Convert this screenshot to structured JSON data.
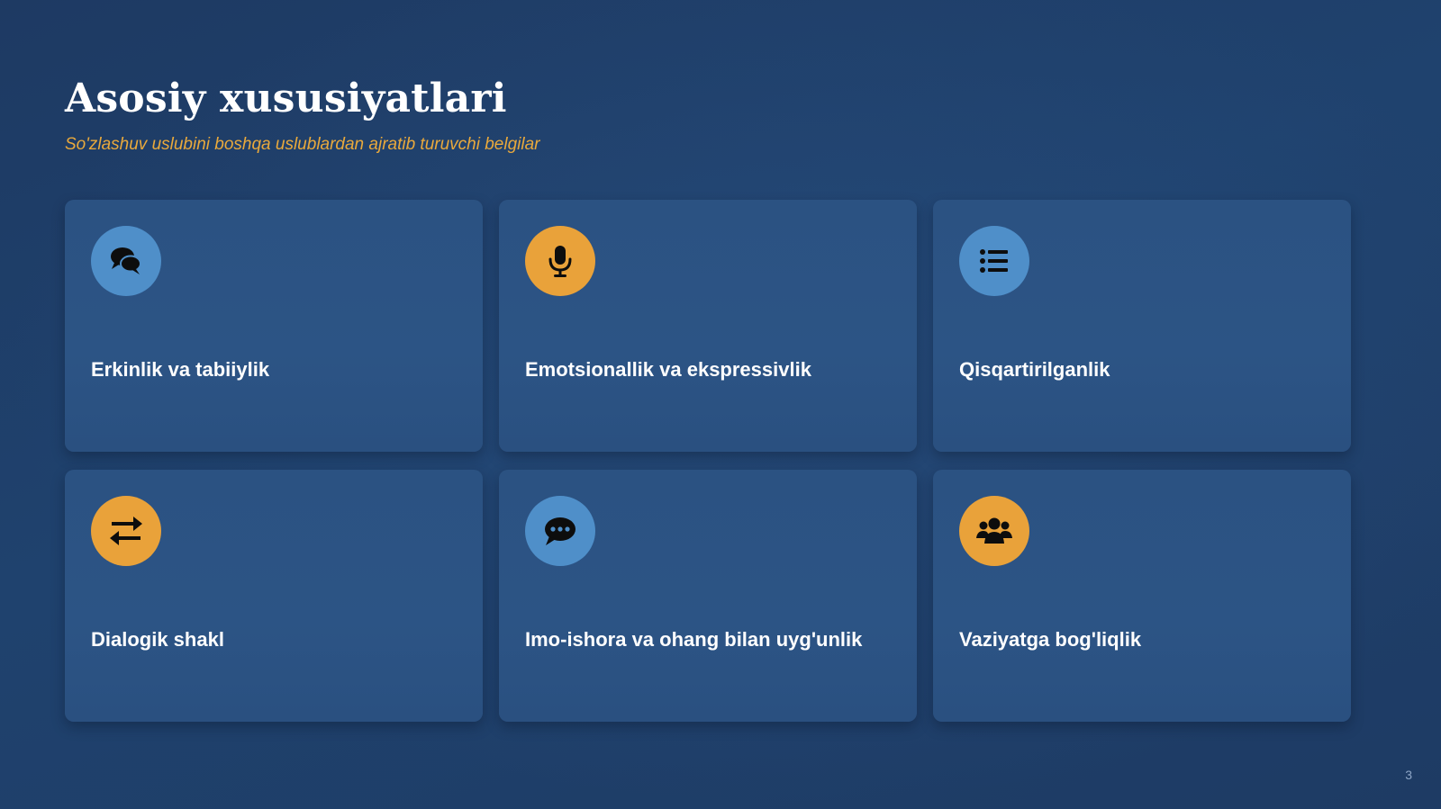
{
  "slide": {
    "title": "Asosiy xususiyatlari",
    "subtitle": "So'zlashuv uslubini boshqa uslublardan ajratib turuvchi belgilar",
    "page_number": "3"
  },
  "colors": {
    "background": "#1f3f6b",
    "card": "#2b5282",
    "accent_blue": "#4f8fc9",
    "accent_orange": "#e9a23a",
    "subtitle": "#e9a93c"
  },
  "cards": [
    {
      "label": "Erkinlik va tabiiylik",
      "icon": "comments-icon",
      "icon_color": "blue"
    },
    {
      "label": "Emotsionallik va ekspressivlik",
      "icon": "microphone-icon",
      "icon_color": "orange"
    },
    {
      "label": "Qisqartirilganlik",
      "icon": "list-icon",
      "icon_color": "blue"
    },
    {
      "label": "Dialogik shakl",
      "icon": "exchange-arrows-icon",
      "icon_color": "orange"
    },
    {
      "label": "Imo-ishora va ohang bilan uyg'unlik",
      "icon": "comment-dots-icon",
      "icon_color": "blue"
    },
    {
      "label": "Vaziyatga bog'liqlik",
      "icon": "users-icon",
      "icon_color": "orange"
    }
  ]
}
